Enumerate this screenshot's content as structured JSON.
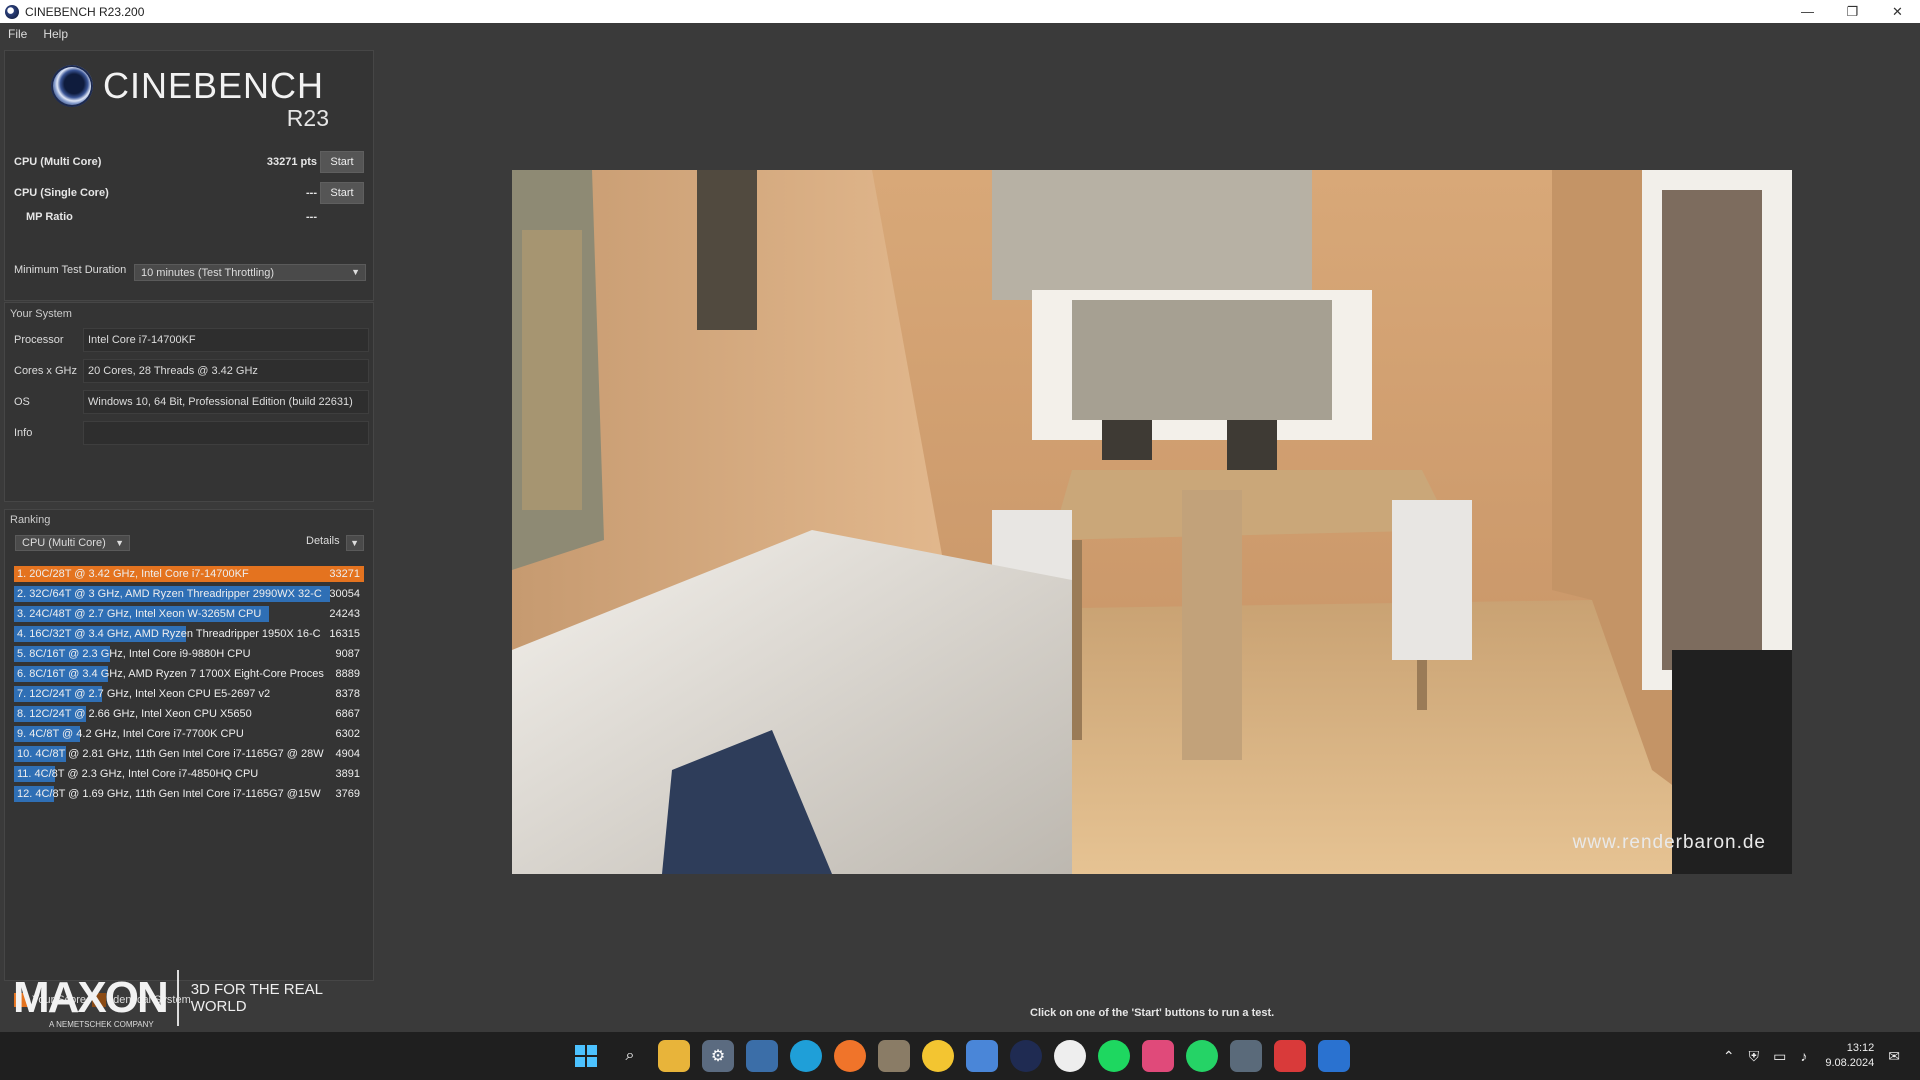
{
  "window": {
    "title": "CINEBENCH R23.200",
    "minimize": "—",
    "maximize": "❐",
    "close": "✕"
  },
  "menu": [
    "File",
    "Help"
  ],
  "logo": {
    "title": "CINEBENCH",
    "version": "R23"
  },
  "tests": {
    "multi": {
      "label": "CPU (Multi Core)",
      "score": "33271 pts",
      "button": "Start"
    },
    "single": {
      "label": "CPU (Single Core)",
      "score": "---",
      "button": "Start"
    },
    "mp_ratio": {
      "label": "MP Ratio",
      "score": "---"
    }
  },
  "duration": {
    "label": "Minimum Test Duration",
    "value": "10 minutes (Test Throttling)"
  },
  "system": {
    "title": "Your System",
    "rows": [
      {
        "k": "Processor",
        "v": "Intel Core i7-14700KF"
      },
      {
        "k": "Cores x GHz",
        "v": "20 Cores, 28 Threads @ 3.42 GHz"
      },
      {
        "k": "OS",
        "v": "Windows 10, 64 Bit, Professional Edition (build 22631)"
      },
      {
        "k": "Info",
        "v": ""
      }
    ]
  },
  "ranking": {
    "title": "Ranking",
    "mode": "CPU (Multi Core)",
    "details": "Details",
    "max_score": 33271,
    "rows": [
      {
        "text": "1. 20C/28T @ 3.42 GHz, Intel Core i7-14700KF",
        "score": 33271,
        "mine": true
      },
      {
        "text": "2. 32C/64T @ 3 GHz, AMD Ryzen Threadripper 2990WX 32-C",
        "score": 30054,
        "mine": false
      },
      {
        "text": "3. 24C/48T @ 2.7 GHz, Intel Xeon W-3265M CPU",
        "score": 24243,
        "mine": false
      },
      {
        "text": "4. 16C/32T @ 3.4 GHz, AMD Ryzen Threadripper 1950X 16-C",
        "score": 16315,
        "mine": false
      },
      {
        "text": "5. 8C/16T @ 2.3 GHz, Intel Core i9-9880H CPU",
        "score": 9087,
        "mine": false
      },
      {
        "text": "6. 8C/16T @ 3.4 GHz, AMD Ryzen 7 1700X Eight-Core Processo",
        "score": 8889,
        "mine": false
      },
      {
        "text": "7. 12C/24T @ 2.7 GHz, Intel Xeon CPU E5-2697 v2",
        "score": 8378,
        "mine": false
      },
      {
        "text": "8. 12C/24T @ 2.66 GHz, Intel Xeon CPU X5650",
        "score": 6867,
        "mine": false
      },
      {
        "text": "9. 4C/8T @ 4.2 GHz, Intel Core i7-7700K CPU",
        "score": 6302,
        "mine": false
      },
      {
        "text": "10. 4C/8T @ 2.81 GHz, 11th Gen Intel Core i7-1165G7 @ 28W",
        "score": 4904,
        "mine": false
      },
      {
        "text": "11. 4C/8T @ 2.3 GHz, Intel Core i7-4850HQ CPU",
        "score": 3891,
        "mine": false
      },
      {
        "text": "12. 4C/8T @ 1.69 GHz, 11th Gen Intel Core i7-1165G7 @15W",
        "score": 3769,
        "mine": false
      }
    ],
    "legend": {
      "your": "Your Score",
      "identical": "Identical System"
    },
    "colors": {
      "your": "#e4731f",
      "identical": "#8a4a14",
      "bar": "#2f6fb5"
    }
  },
  "maxon": {
    "word": "MAXON",
    "sub": "A NEMETSCHEK COMPANY",
    "tagline": "3D FOR THE REAL WORLD"
  },
  "render": {
    "watermark": "www.renderbaron.de"
  },
  "status": "Click on one of the 'Start' buttons to run a test.",
  "taskbar": {
    "time": "13:12",
    "date": "9.08.2024"
  }
}
